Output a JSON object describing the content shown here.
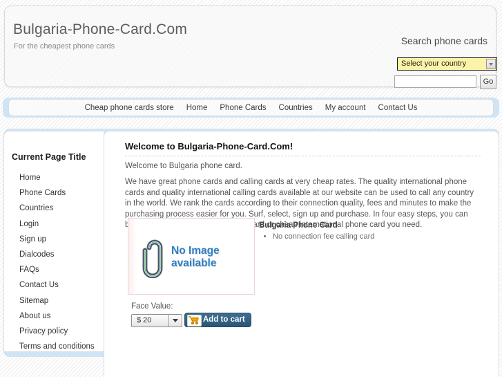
{
  "header": {
    "site_title": "Bulgaria-Phone-Card.Com",
    "tagline": "For the cheapest phone cards",
    "search_label": "Search phone cards",
    "country_select_value": "Select your country",
    "search_placeholder": "",
    "search_value": "",
    "go_label": "Go",
    "select_bg_color": "#fbf4a8"
  },
  "nav": {
    "items": [
      {
        "label": "Cheap phone cards store"
      },
      {
        "label": "Home"
      },
      {
        "label": "Phone Cards"
      },
      {
        "label": "Countries"
      },
      {
        "label": "My account"
      },
      {
        "label": "Contact Us"
      }
    ]
  },
  "sidebar": {
    "title": "Current Page Title",
    "items": [
      {
        "label": "Home"
      },
      {
        "label": "Phone Cards"
      },
      {
        "label": "Countries"
      },
      {
        "label": "Login"
      },
      {
        "label": "Sign up"
      },
      {
        "label": "Dialcodes"
      },
      {
        "label": "FAQs"
      },
      {
        "label": "Contact Us"
      },
      {
        "label": "Sitemap"
      },
      {
        "label": "About us"
      },
      {
        "label": "Privacy policy"
      },
      {
        "label": "Terms and conditions"
      }
    ]
  },
  "main": {
    "heading": "Welcome to Bulgaria-Phone-Card.Com!",
    "intro": "Welcome to Bulgaria phone card.",
    "body": "We have great phone cards and calling cards at very cheap rates. The quality international phone cards and quality international calling cards available at our website can be used to call any country in the world. We rank the cards according to their connection quality, fees and minutes to make the purchasing process easier for you. Surf, select, sign up and purchase. In four easy steps, you can buy any cheap international calling card or cheap international phone card you need."
  },
  "product": {
    "no_image_text": "No Image available",
    "name": "Bulgaria Phone Card",
    "bullets": [
      {
        "text": "No connection fee calling card"
      }
    ],
    "face_value_label": "Face Value:",
    "face_value_selected": "$ 20",
    "add_to_cart_label": "Add to cart",
    "accent_color": "#2f7fc4",
    "cart_button_color": "#2b5676"
  }
}
